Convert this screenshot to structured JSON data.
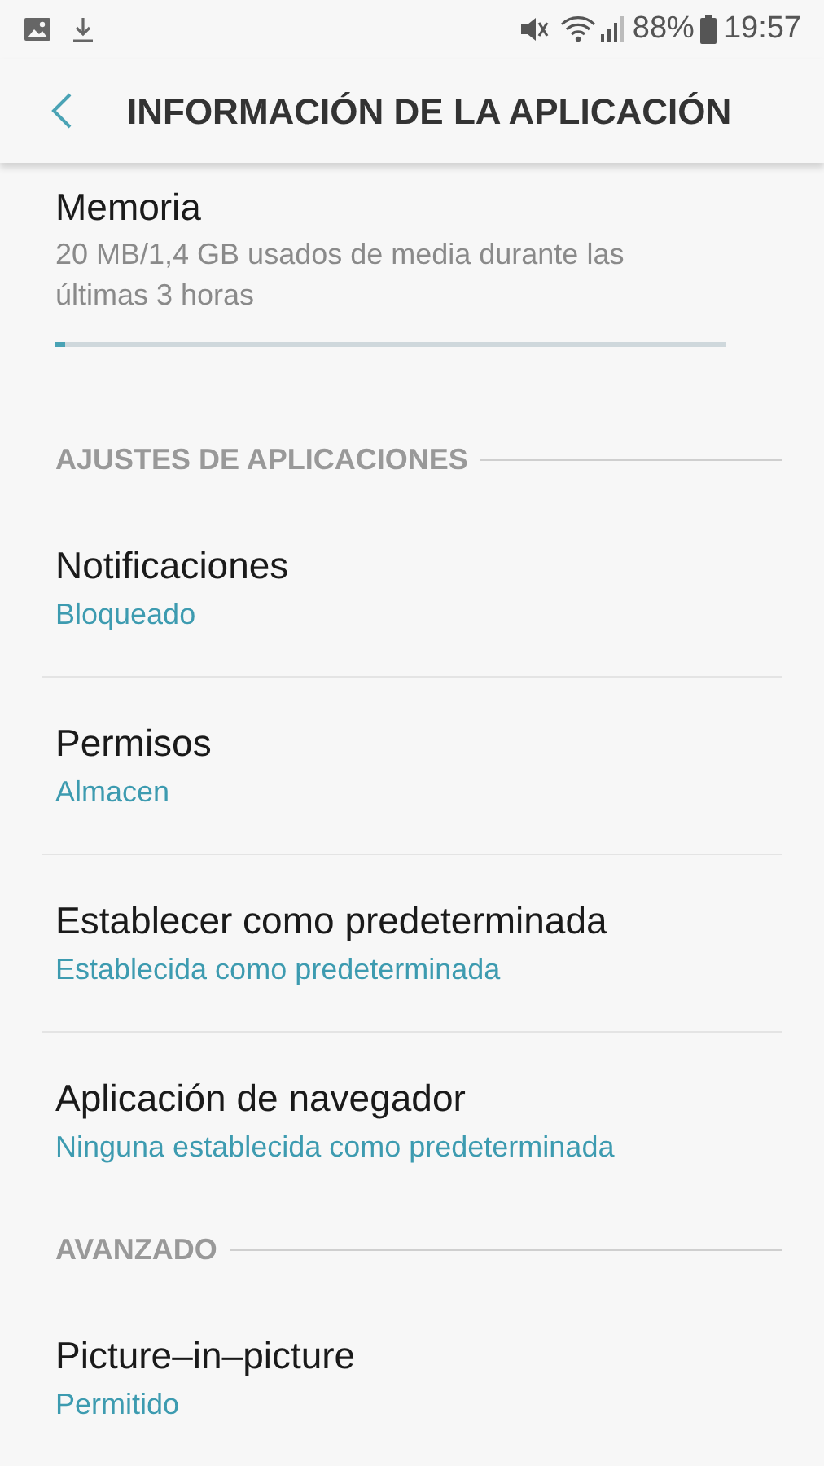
{
  "status_bar": {
    "battery": "88%",
    "time": "19:57"
  },
  "header": {
    "title": "INFORMACIÓN DE LA APLICACIÓN"
  },
  "content": [
    {
      "kind": "usage",
      "title": "Memoria",
      "detail": "20 MB/1,4 GB usados de media durante las últimas 3 horas",
      "level": 0.015
    },
    {
      "kind": "header",
      "title": "AJUSTES DE APLICACIONES"
    },
    {
      "kind": "setting",
      "title": "Notificaciones",
      "value": "Bloqueado"
    },
    {
      "kind": "setting",
      "title": "Permisos",
      "value": "Almacen"
    },
    {
      "kind": "setting",
      "title": "Establecer como predeterminada",
      "value": "Establecida como predeterminada"
    },
    {
      "kind": "setting",
      "title": "Aplicación de navegador",
      "value": "Ninguna establecida como predeterminada"
    },
    {
      "kind": "header",
      "title": "AVANZADO"
    },
    {
      "kind": "setting",
      "title": "Picture–in–picture",
      "value": "Permitido"
    }
  ]
}
